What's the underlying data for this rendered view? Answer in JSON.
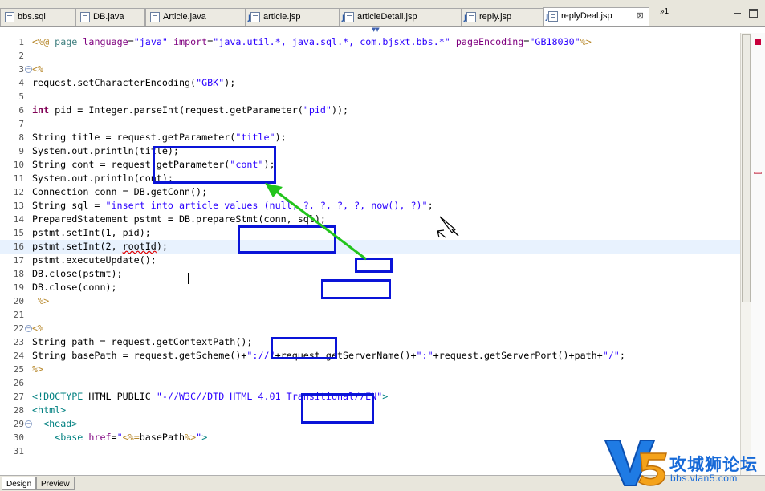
{
  "tabs": [
    {
      "label": "bbs.sql",
      "icon": "sql-file-icon",
      "active": false
    },
    {
      "label": "DB.java",
      "icon": "java-file-icon",
      "active": false
    },
    {
      "label": "Article.java",
      "icon": "java-file-icon",
      "active": false
    },
    {
      "label": "article.jsp",
      "icon": "jsp-file-icon",
      "active": false
    },
    {
      "label": "articleDetail.jsp",
      "icon": "jsp-file-icon",
      "active": false
    },
    {
      "label": "reply.jsp",
      "icon": "jsp-file-icon",
      "active": false
    },
    {
      "label": "replyDeal.jsp",
      "icon": "jsp-file-icon",
      "active": true
    }
  ],
  "tab_overflow": "»1",
  "editor": {
    "current_line": 16,
    "lines": [
      {
        "n": "1",
        "fold": "",
        "html": "<span style=\"color:#b7882c\">&lt;%@</span> <span style=\"color:#3f7f7f\">page</span> <span style=\"color:#7f007f\">language</span>=<span style=\"color:#2a00ff\">\"java\"</span> <span style=\"color:#7f007f\">import</span>=<span style=\"color:#2a00ff\">\"java.util.*, java.sql.*, com.bjsxt.bbs.*\"</span> <span style=\"color:#7f007f\">pageEncoding</span>=<span style=\"color:#2a00ff\">\"GB18030\"</span><span style=\"color:#b7882c\">%&gt;</span>"
      },
      {
        "n": "2",
        "fold": "",
        "html": ""
      },
      {
        "n": "3",
        "fold": "−",
        "html": "<span style=\"color:#b7882c\">&lt;%</span>"
      },
      {
        "n": "4",
        "fold": "",
        "html": "request.setCharacterEncoding(<span style=\"color:#2a00ff\">\"GBK\"</span>);"
      },
      {
        "n": "5",
        "fold": "",
        "html": ""
      },
      {
        "n": "6",
        "fold": "",
        "html": "<span style=\"color:#7f0055;font-weight:bold\">int</span> pid = Integer.parseInt(request.getParameter(<span style=\"color:#2a00ff\">\"pid\"</span>));"
      },
      {
        "n": "7",
        "fold": "",
        "html": ""
      },
      {
        "n": "8",
        "fold": "",
        "html": "String title = request.getParameter(<span style=\"color:#2a00ff\">\"title\"</span>);"
      },
      {
        "n": "9",
        "fold": "",
        "html": "System.out.println(title);"
      },
      {
        "n": "10",
        "fold": "",
        "html": "String cont = request.getParameter(<span style=\"color:#2a00ff\">\"cont\"</span>);"
      },
      {
        "n": "11",
        "fold": "",
        "html": "System.out.println(cont);"
      },
      {
        "n": "12",
        "fold": "",
        "html": "Connection conn = DB.getConn();"
      },
      {
        "n": "13",
        "fold": "",
        "html": "String sql = <span style=\"color:#2a00ff\">\"insert into article values (null, ?, ?, ?, ?, now(), ?)\"</span>;"
      },
      {
        "n": "14",
        "fold": "",
        "html": "PreparedStatement pstmt = DB.prepareStmt(conn, sql);"
      },
      {
        "n": "15",
        "fold": "",
        "html": "pstmt.setInt(1, pid);"
      },
      {
        "n": "16",
        "fold": "",
        "html": "pstmt.setInt(2, <span style=\"text-decoration:underline wavy #e00000\">rootId</span>);"
      },
      {
        "n": "17",
        "fold": "",
        "html": "pstmt.executeUpdate();"
      },
      {
        "n": "18",
        "fold": "",
        "html": "DB.close(pstmt);"
      },
      {
        "n": "19",
        "fold": "",
        "html": "DB.close(conn);"
      },
      {
        "n": "20",
        "fold": "",
        "html": " <span style=\"color:#b7882c\">%&gt;</span>"
      },
      {
        "n": "21",
        "fold": "",
        "html": ""
      },
      {
        "n": "22",
        "fold": "−",
        "html": "<span style=\"color:#b7882c\">&lt;%</span>"
      },
      {
        "n": "23",
        "fold": "",
        "html": "String path = request.getContextPath();"
      },
      {
        "n": "24",
        "fold": "",
        "html": "String basePath = request.getScheme()+<span style=\"color:#2a00ff\">\"://\"</span>+request.getServerName()+<span style=\"color:#2a00ff\">\":\"</span>+request.getServerPort()+path+<span style=\"color:#2a00ff\">\"/\"</span>;"
      },
      {
        "n": "25",
        "fold": "",
        "html": "<span style=\"color:#b7882c\">%&gt;</span>"
      },
      {
        "n": "26",
        "fold": "",
        "html": ""
      },
      {
        "n": "27",
        "fold": "",
        "html": "<span style=\"color:#008080\">&lt;!DOCTYPE</span> HTML PUBLIC <span style=\"color:#2a00ff\">\"-//W3C//DTD HTML 4.01 Transitional//EN\"</span><span style=\"color:#008080\">&gt;</span>"
      },
      {
        "n": "28",
        "fold": "",
        "html": "<span style=\"color:#008080\">&lt;html&gt;</span>"
      },
      {
        "n": "29",
        "fold": "−",
        "html": "  <span style=\"color:#008080\">&lt;head&gt;</span>"
      },
      {
        "n": "30",
        "fold": "",
        "html": "    <span style=\"color:#008080\">&lt;base</span> <span style=\"color:#7f007f\">href</span>=<span style=\"color:#2a00ff\">\"</span><span style=\"color:#b7882c\">&lt;%=</span>basePath<span style=\"color:#b7882c\">%&gt;</span><span style=\"color:#2a00ff\">\"</span><span style=\"color:#008080\">&gt;</span>"
      },
      {
        "n": "31",
        "fold": "",
        "html": ""
      }
    ]
  },
  "bottom_tabs": [
    {
      "label": "Design",
      "active": true
    },
    {
      "label": "Preview",
      "active": false
    }
  ],
  "watermark": {
    "brand": "攻城狮论坛",
    "url": "bbs.vlan5.com",
    "colors": {
      "primary": "#176ad8",
      "accent": "#f4a21a"
    }
  },
  "annotation_color": "#0a14d8",
  "arrow_color": "#22c41c"
}
